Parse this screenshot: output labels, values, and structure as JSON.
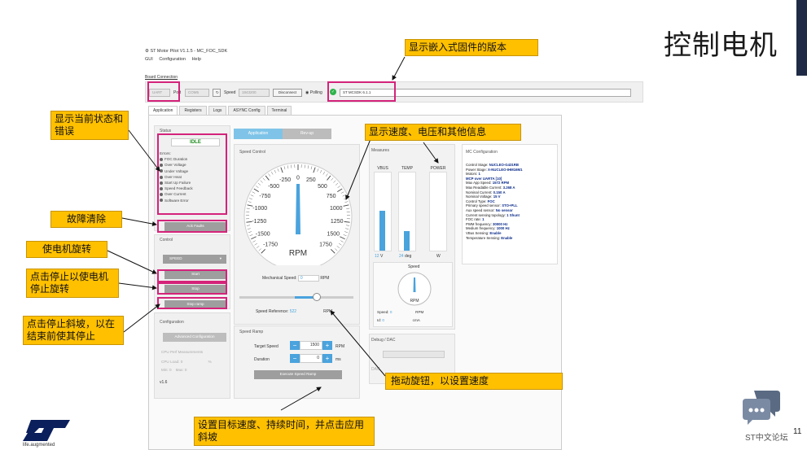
{
  "slide": {
    "title": "控制电机",
    "page_number": "11",
    "footer_brand": "ST中文论坛",
    "tagline": "life.augmented"
  },
  "app": {
    "window_title": "ST Motor Pilot V1.1.5 - MC_FOC_SDK",
    "menu": [
      "GUI",
      "Configuration",
      "Help"
    ],
    "board_connection_label": "Board Connection",
    "conn_type": "UART",
    "port_label": "Port",
    "port_value": "COM5",
    "speed_label": "Speed",
    "speed_value": "1843200",
    "disconnect_label": "Disconnect",
    "polling_label": "Polling",
    "firmware_version": "ST MCSDK 6.1.1",
    "tabs": [
      "Application",
      "Registers",
      "Logs",
      "ASYNC Config",
      "Terminal"
    ],
    "status": {
      "title": "Status",
      "state": "IDLE",
      "errors_label": "Errors:",
      "errors": [
        "FOC Duration",
        "Over Voltage",
        "Under Voltage",
        "Over Heat",
        "Start Up Failure",
        "Speed Feedback",
        "Over Current",
        "Software Error"
      ],
      "ack_label": "Ack Faults"
    },
    "control": {
      "title": "Control",
      "mode": "SPEED",
      "start_label": "Start",
      "stop_label": "Stop",
      "stop_ramp_label": "Stop ramp"
    },
    "configuration": {
      "title": "Configuration",
      "advanced_label": "Advanced Configuration",
      "cpu_label": "CPU Perf Measurements",
      "cpu_load_label": "CPU Load:",
      "cpu_load_value": "0",
      "cpu_unit": "%",
      "min_label": "Min:",
      "min_value": "0",
      "max_label": "Max:",
      "max_value": "0",
      "version": "v1.6"
    },
    "view_tabs": {
      "application": "Application",
      "rev_up": "Rev-up"
    },
    "speed_control": {
      "title": "Speed Control",
      "gauge_labels": [
        "-1750",
        "-1500",
        "-1250",
        "-1000",
        "-750",
        "-500",
        "-250",
        "0",
        "250",
        "500",
        "750",
        "1000",
        "1250",
        "1500",
        "1750"
      ],
      "gauge_unit": "RPM",
      "mech_speed_label": "Mechanical Speed:",
      "mech_speed_value": "0",
      "mech_speed_unit": "RPM",
      "ref_label": "Speed Reference:",
      "ref_value": "522",
      "ref_unit": "RPM"
    },
    "speed_ramp": {
      "title": "Speed Ramp",
      "target_label": "Target Speed",
      "target_value": "1500",
      "target_unit": "RPM",
      "duration_label": "Duration",
      "duration_value": "0",
      "duration_unit": "ms",
      "execute_label": "Execute Speed Ramp"
    },
    "measures": {
      "title": "Measures",
      "vbus_label": "VBUS",
      "vbus_value": "12",
      "vbus_unit": "V",
      "vbus_fraction": 0.5,
      "temp_label": "TEMP",
      "temp_value": "24",
      "temp_unit": "deg",
      "temp_fraction": 0.24,
      "power_label": "POWER",
      "power_value": "",
      "power_unit": "W",
      "power_fraction": 0,
      "speed_gauge_title": "Speed",
      "speed_gauge_unit": "RPM",
      "speed_label": "Speed:",
      "speed_value": "0",
      "speed_unit": "RPM",
      "iq_label": "Id:",
      "iq_value": "0",
      "iq_unit": "cmA"
    },
    "mc_configuration": {
      "title": "MC Configuration",
      "lines": [
        [
          "Control Stage:",
          "NUCLEO-G431RB"
        ],
        [
          "Power Stage:",
          "X-NUCLEO-IHM16M1"
        ],
        [
          "Motors:",
          "1"
        ],
        [
          "",
          "MCP over UARTA [10]"
        ],
        [
          "Max App Speed:",
          "1572 RPM"
        ],
        [
          "Max Readable Current:",
          "3.268 A"
        ],
        [
          "Nominal Current:",
          "0.150 A"
        ],
        [
          "Nominal Voltage:",
          "15 V"
        ],
        [
          "Control Type:",
          "FOC"
        ],
        [
          "Primary speed sensor:",
          "STO+PLL"
        ],
        [
          "Aux speed sensor:",
          "No sensor"
        ],
        [
          "Current sensing topology:",
          "1 Shunt"
        ],
        [
          "FOC rate:",
          "1"
        ],
        [
          "PWM frequency:",
          "30000 Hz"
        ],
        [
          "Medium frequency:",
          "1000 Hz"
        ],
        [
          "VBus Sensing:",
          "Enable"
        ],
        [
          "Temperature Sensing:",
          "Enable"
        ]
      ]
    },
    "debug_dac": {
      "title": "Debug / DAC",
      "dac_label": "DAC"
    }
  },
  "callouts": {
    "firmware": "显示嵌入式固件的版本",
    "status": "显示当前状态和错误",
    "measures": "显示速度、电压和其他信息",
    "fault": "故障清除",
    "start": "使电机旋转",
    "stop": "点击停止以使电机停止旋转",
    "stop_ramp": "点击停止斜坡，以在结束前使其停止",
    "knob": "拖动旋钮，以设置速度",
    "ramp": "设置目标速度、持续时间，并点击应用斜坡"
  },
  "colors": {
    "callout_bg": "#ffc000",
    "highlight": "#d4237a",
    "accent": "#4aa3dd",
    "idle_text": "#1a8a1a"
  }
}
